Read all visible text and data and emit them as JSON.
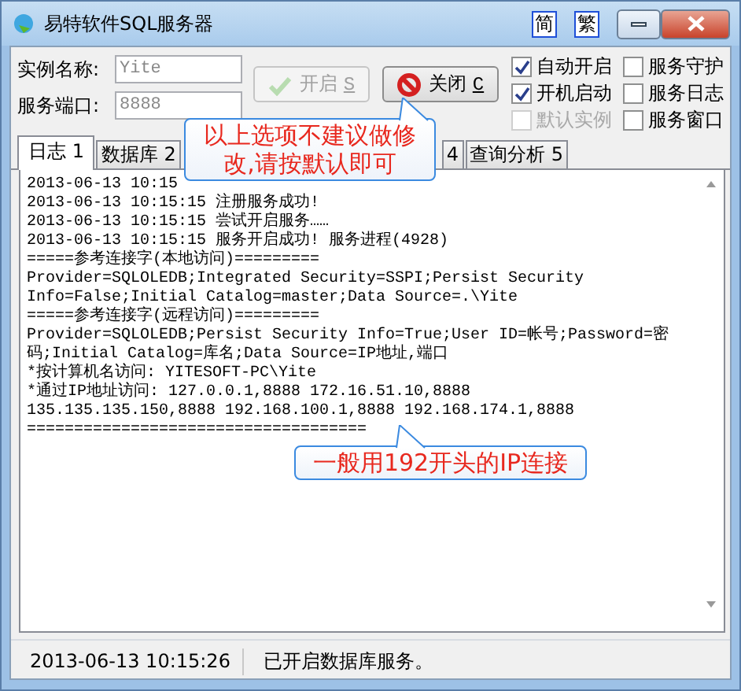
{
  "window": {
    "title": "易特软件SQL服务器",
    "lang_buttons": [
      "简",
      "繁"
    ]
  },
  "fields": [
    {
      "label": "实例名称:",
      "value": "Yite"
    },
    {
      "label": "服务端口:",
      "value": "8888"
    }
  ],
  "buttons": [
    {
      "label": "开启",
      "accel": "S",
      "disabled": true,
      "kind": "start"
    },
    {
      "label": "关闭",
      "accel": "C",
      "disabled": false,
      "kind": "stop"
    }
  ],
  "options": [
    {
      "label": "自动开启",
      "checked": true,
      "disabled": false
    },
    {
      "label": "服务守护",
      "checked": false,
      "disabled": false
    },
    {
      "label": "开机启动",
      "checked": true,
      "disabled": false
    },
    {
      "label": "服务日志",
      "checked": false,
      "disabled": false
    },
    {
      "label": "默认实例",
      "checked": false,
      "disabled": true
    },
    {
      "label": "服务窗口",
      "checked": false,
      "disabled": false
    }
  ],
  "tabs": [
    {
      "label": "日志 1",
      "selected": true
    },
    {
      "label": "数据库 2",
      "selected": false
    },
    {
      "label": "4",
      "selected": false
    },
    {
      "label": "查询分析 5",
      "selected": false
    }
  ],
  "log": [
    "2013-06-13 10:15",
    "2013-06-13 10:15:15 注册服务成功!",
    "2013-06-13 10:15:15 尝试开启服务……",
    "2013-06-13 10:15:15 服务开启成功! 服务进程(4928)",
    "=====参考连接字(本地访问)=========",
    "Provider=SQLOLEDB;Integrated Security=SSPI;Persist Security",
    "Info=False;Initial Catalog=master;Data Source=.\\Yite",
    "=====参考连接字(远程访问)=========",
    "Provider=SQLOLEDB;Persist Security Info=True;User ID=帐号;Password=密",
    "码;Initial Catalog=库名;Data Source=IP地址,端口",
    "*按计算机名访问: YITESOFT-PC\\Yite",
    "*通过IP地址访问: 127.0.0.1,8888 172.16.51.10,8888",
    "135.135.135.150,8888 192.168.100.1,8888 192.168.174.1,8888",
    "===================================="
  ],
  "callouts": [
    "以上选项不建议做修改,请按默认即可",
    "一般用192开头的IP连接"
  ],
  "status_bar": [
    "2013-06-13 10:15:26",
    "已开启数据库服务。"
  ]
}
